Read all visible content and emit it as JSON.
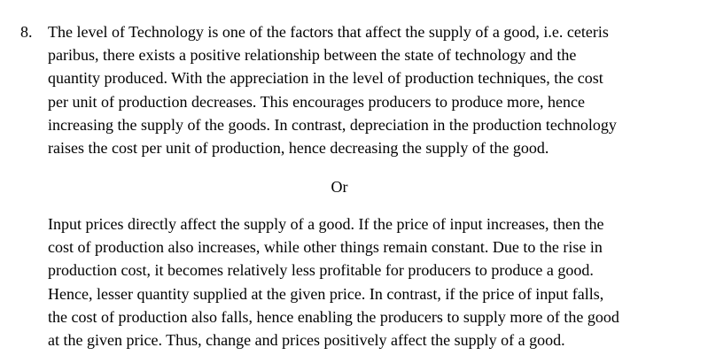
{
  "document": {
    "item_number": "8.",
    "paragraph1_lines": [
      "The level of Technology is one of the factors that affect the supply of a good, i.e. ceteris",
      "paribus, there exists a positive relationship between the state of technology and the",
      "quantity produced. With the appreciation in the level of production techniques, the cost",
      "per unit of production decreases. This encourages producers to produce more, hence",
      "increasing the supply of the goods. In contrast, depreciation in the production technology",
      "raises the cost per unit of production, hence decreasing the supply of the good."
    ],
    "separator": "Or",
    "paragraph2_lines": [
      "Input prices directly affect the supply of a good. If the price of input increases, then the",
      "cost of production also increases, while other things remain constant. Due to the rise in",
      "production cost, it becomes relatively less profitable for producers to produce a good.",
      "Hence, lesser quantity supplied at the given price. In contrast, if the price of input falls,",
      "the cost of production also falls, hence enabling the producers to supply more of the good",
      "at the given price. Thus, change and prices positively affect the supply of a good."
    ]
  }
}
